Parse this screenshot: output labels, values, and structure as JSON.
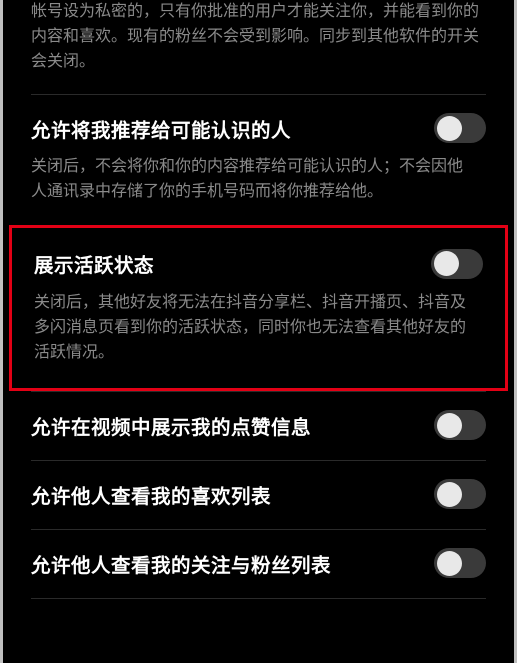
{
  "settings": {
    "privateAccount": {
      "desc": "帐号设为私密的，只有你批准的用户才能关注你，并能看到你的内容和喜欢。现有的粉丝不会受到影响。同步到其他软件的开关会关闭。"
    },
    "recommendToKnown": {
      "title": "允许将我推荐给可能认识的人",
      "desc": "关闭后，不会将你和你的内容推荐给可能认识的人；不会因他人通讯录中存储了你的手机号码而将你推荐给他。"
    },
    "activeStatus": {
      "title": "展示活跃状态",
      "desc": "关闭后，其他好友将无法在抖音分享栏、抖音开播页、抖音及多闪消息页看到你的活跃状态，同时你也无法查看其他好友的活跃情况。"
    },
    "showLikeInVideo": {
      "title": "允许在视频中展示我的点赞信息"
    },
    "viewLikedList": {
      "title": "允许他人查看我的喜欢列表"
    },
    "viewFollowList": {
      "title": "允许他人查看我的关注与粉丝列表"
    }
  }
}
